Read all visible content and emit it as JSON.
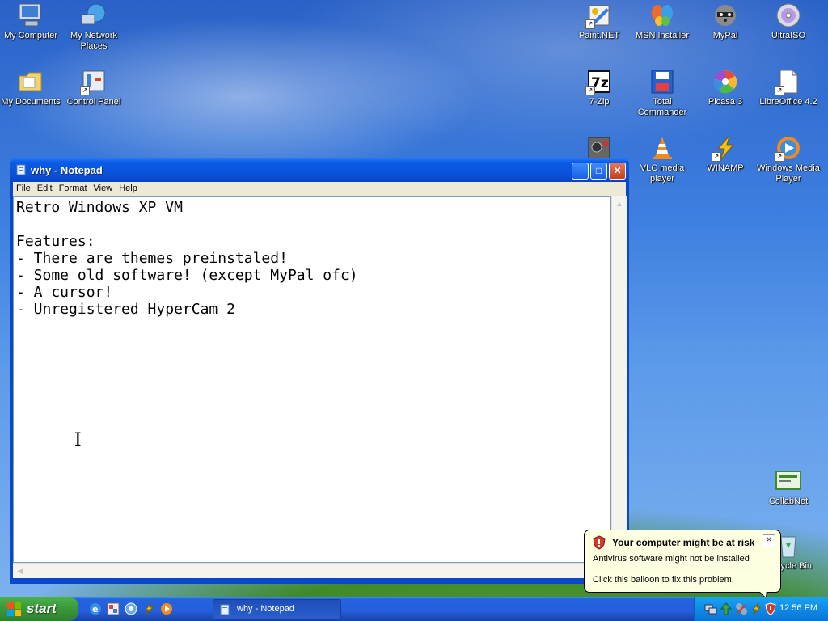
{
  "desktop_icons": {
    "my_computer": "My Computer",
    "my_network_places": "My Network Places",
    "my_documents": "My Documents",
    "control_panel": "Control Panel",
    "paint_net": "Paint.NET",
    "msn_installer": "MSN Installer",
    "mypal": "MyPal",
    "ultraiso": "UltraISO",
    "seven_zip": "7-Zip",
    "total_commander": "Total Commander",
    "picasa": "Picasa 3",
    "libreoffice": "LibreOffice 4.2",
    "vlc": "VLC media player",
    "winamp": "WINAMP",
    "wmp": "Windows Media Player",
    "collabnet": "CollabNet",
    "recycle_bin": "Recycle Bin"
  },
  "notepad": {
    "title": "why - Notepad",
    "menu": [
      "File",
      "Edit",
      "Format",
      "View",
      "Help"
    ],
    "content": "Retro Windows XP VM\n\nFeatures:\n- There are themes preinstaled!\n- Some old software! (except MyPal ofc)\n- A cursor!\n- Unregistered HyperCam 2"
  },
  "balloon": {
    "title": "Your computer might be at risk",
    "line1": "Antivirus software might not be installed",
    "line2": "Click this balloon to fix this problem."
  },
  "taskbar": {
    "start_label": "start",
    "task_label": "why - Notepad",
    "clock": "12:56 PM"
  },
  "colors": {
    "titlebar": "#0a52d8",
    "start_green": "#3c9d3c",
    "tray_blue": "#0f8ae8"
  }
}
